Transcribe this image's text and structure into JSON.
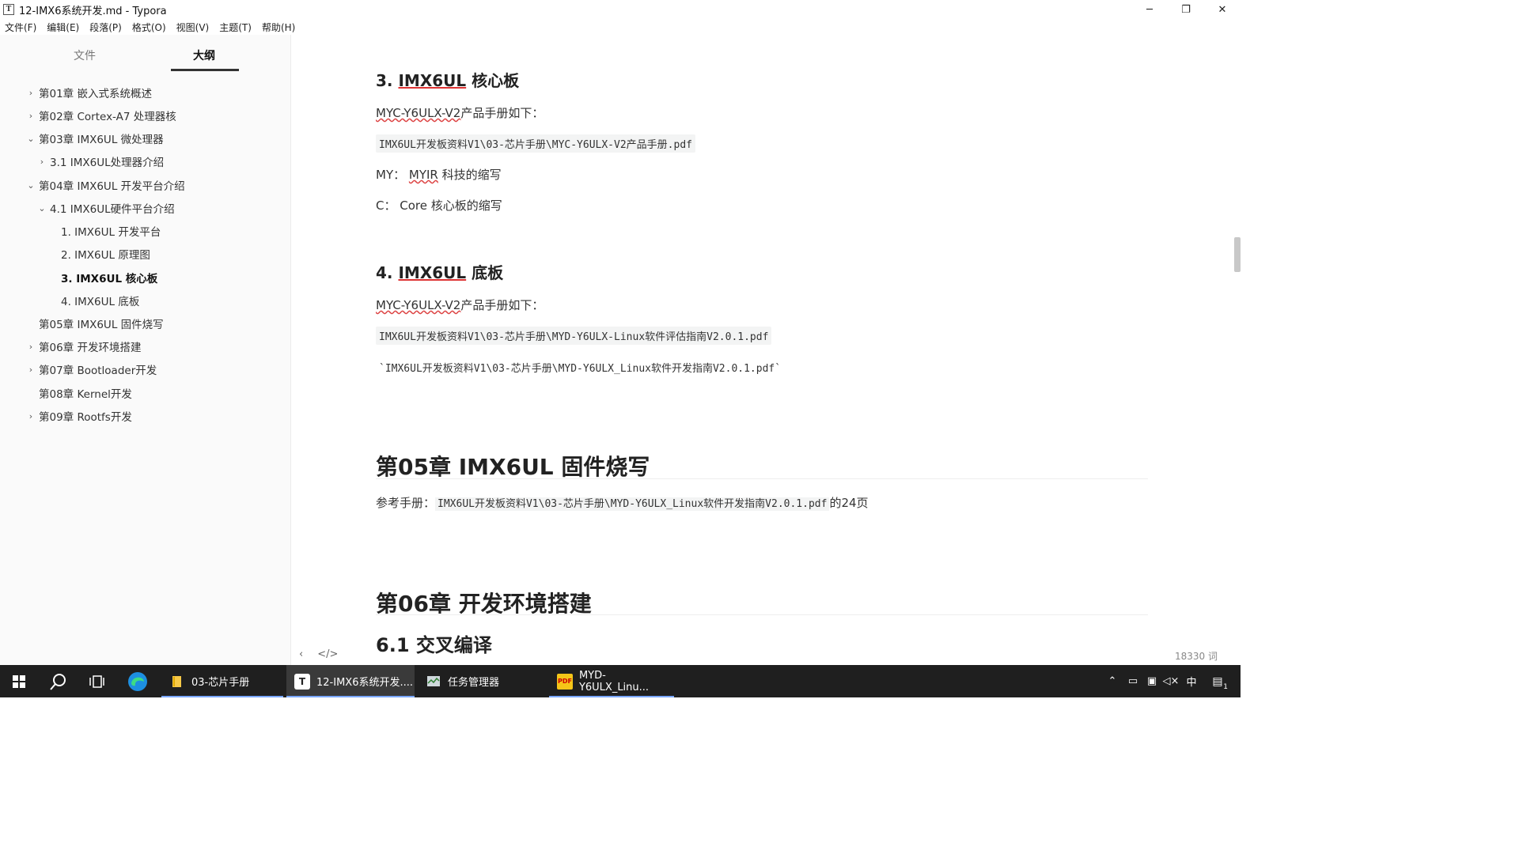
{
  "window": {
    "title": "12-IMX6系统开发.md - Typora",
    "app_icon": "T",
    "controls": {
      "minimize": "─",
      "restore": "❐",
      "close": "✕"
    }
  },
  "menu": [
    "文件(F)",
    "编辑(E)",
    "段落(P)",
    "格式(O)",
    "视图(V)",
    "主题(T)",
    "帮助(H)"
  ],
  "sidebar": {
    "tabs": {
      "files": "文件",
      "outline": "大纲"
    },
    "outline": [
      {
        "label": "第01章 嵌入式系统概述",
        "chevron": "›"
      },
      {
        "label": "第02章 Cortex-A7 处理器核",
        "chevron": "›"
      },
      {
        "label": "第03章 IMX6UL 微处理器",
        "chevron": "⌄"
      },
      {
        "label": "3.1 IMX6UL处理器介绍",
        "chevron": "›"
      },
      {
        "label": "第04章 IMX6UL 开发平台介绍",
        "chevron": "⌄"
      },
      {
        "label": "4.1 IMX6UL硬件平台介绍",
        "chevron": "⌄"
      },
      {
        "label": "1. IMX6UL 开发平台",
        "chevron": ""
      },
      {
        "label": "2. IMX6UL 原理图",
        "chevron": ""
      },
      {
        "label": "3. IMX6UL 核心板",
        "chevron": ""
      },
      {
        "label": "4. IMX6UL 底板",
        "chevron": ""
      },
      {
        "label": "第05章 IMX6UL 固件烧写",
        "chevron": ""
      },
      {
        "label": "第06章 开发环境搭建",
        "chevron": "›"
      },
      {
        "label": "第07章 Bootloader开发",
        "chevron": "›"
      },
      {
        "label": "第08章 Kernel开发",
        "chevron": ""
      },
      {
        "label": "第09章 Rootfs开发",
        "chevron": "›"
      }
    ]
  },
  "doc": {
    "s3_heading_num": "3. ",
    "s3_heading_ul": "IMX6UL",
    "s3_heading_rest": " 核心板",
    "s3_p1_sq": "MYC-Y6ULX-V2",
    "s3_p1_rest": "产品手册如下：",
    "s3_code": "IMX6UL开发板资料V1\\03-芯片手册\\MYC-Y6ULX-V2产品手册.pdf",
    "s3_p2_a": "MY：  ",
    "s3_p2_sq": "MYIR",
    "s3_p2_b": " 科技的缩写",
    "s3_p3": "C：  Core  核心板的缩写",
    "s4_heading_num": "4. ",
    "s4_heading_ul": "IMX6UL",
    "s4_heading_rest": " 底板",
    "s4_p1_sq": "MYC-Y6ULX-V2",
    "s4_p1_rest": "产品手册如下：",
    "s4_code1": "IMX6UL开发板资料V1\\03-芯片手册\\MYD-Y6ULX-Linux软件评估指南V2.0.1.pdf",
    "s4_code2": "`IMX6UL开发板资料V1\\03-芯片手册\\MYD-Y6ULX_Linux软件开发指南V2.0.1.pdf`",
    "ch5_title": "第05章 IMX6UL 固件烧写",
    "ch5_p_a": "参考手册：",
    "ch5_p_code": "IMX6UL开发板资料V1\\03-芯片手册\\MYD-Y6ULX_Linux软件开发指南V2.0.1.pdf",
    "ch5_p_b": "的24页",
    "ch6_title": "第06章 开发环境搭建",
    "ch6_1_title": "6.1 交叉编译"
  },
  "footer": {
    "back": "‹",
    "source": "</>",
    "word_count": "18330 词"
  },
  "taskbar": {
    "apps": [
      {
        "label": "03-芯片手册",
        "icon": "folder-icon"
      },
      {
        "label": "12-IMX6系统开发....",
        "icon": "typora-icon"
      },
      {
        "label": "任务管理器",
        "icon": "task-manager-icon"
      },
      {
        "label": "MYD-Y6ULX_Linu...",
        "icon": "pdf-icon"
      }
    ],
    "tray": {
      "ime": "中",
      "notification_count": "1"
    }
  }
}
